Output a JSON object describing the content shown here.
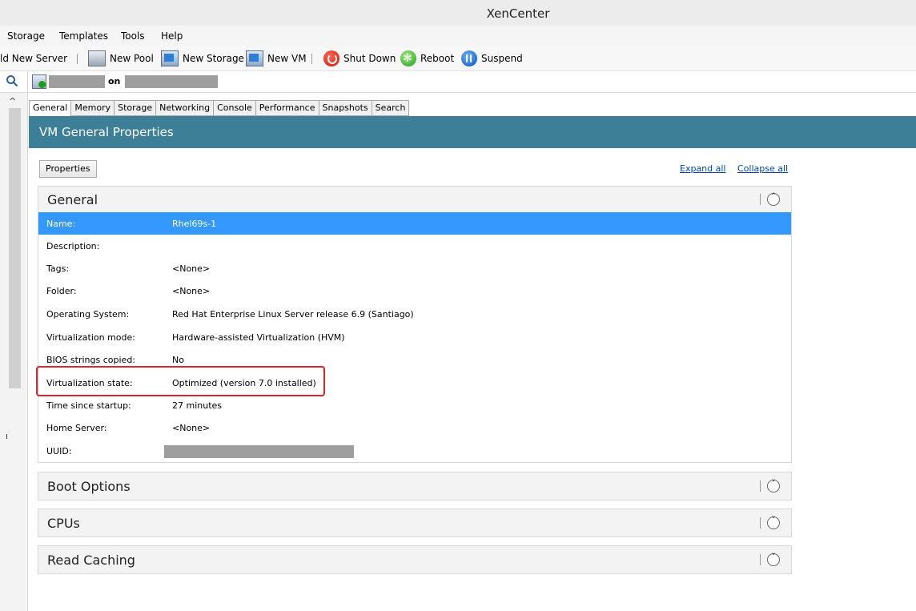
{
  "window": {
    "title": "XenCenter"
  },
  "menu": [
    "Storage",
    "Templates",
    "Tools",
    "Help"
  ],
  "toolbar": {
    "add_server": "ld New Server",
    "new_pool": "New Pool",
    "new_storage": "New Storage",
    "new_vm": "New VM",
    "shut_down": "Shut Down",
    "reboot": "Reboot",
    "suspend": "Suspend"
  },
  "location": {
    "connector": "on"
  },
  "tabs": [
    "General",
    "Memory",
    "Storage",
    "Networking",
    "Console",
    "Performance",
    "Snapshots",
    "Search"
  ],
  "banner": {
    "title": "VM General Properties"
  },
  "actions": {
    "properties": "Properties",
    "expand_all": "Expand all",
    "collapse_all": "Collapse all"
  },
  "general": {
    "title": "General",
    "rows": [
      {
        "label": "Name:",
        "value": "Rhel69s-1"
      },
      {
        "label": "Description:",
        "value": ""
      },
      {
        "label": "Tags:",
        "value": "<None>"
      },
      {
        "label": "Folder:",
        "value": "<None>"
      },
      {
        "label": "Operating System:",
        "value": "Red Hat Enterprise Linux Server release 6.9 (Santiago)"
      },
      {
        "label": "Virtualization mode:",
        "value": "Hardware-assisted Virtualization (HVM)"
      },
      {
        "label": "BIOS strings copied:",
        "value": "No"
      },
      {
        "label": "Virtualization state:",
        "value": "Optimized (version 7.0 installed)"
      },
      {
        "label": "Time since startup:",
        "value": "27 minutes"
      },
      {
        "label": "Home Server:",
        "value": "<None>"
      },
      {
        "label": "UUID:",
        "value": ""
      }
    ]
  },
  "sections": [
    "Boot Options",
    "CPUs",
    "Read Caching"
  ],
  "colors": {
    "banner": "#3d7f96",
    "selected_row": "#3399ff",
    "highlight_box": "#e0202a"
  }
}
